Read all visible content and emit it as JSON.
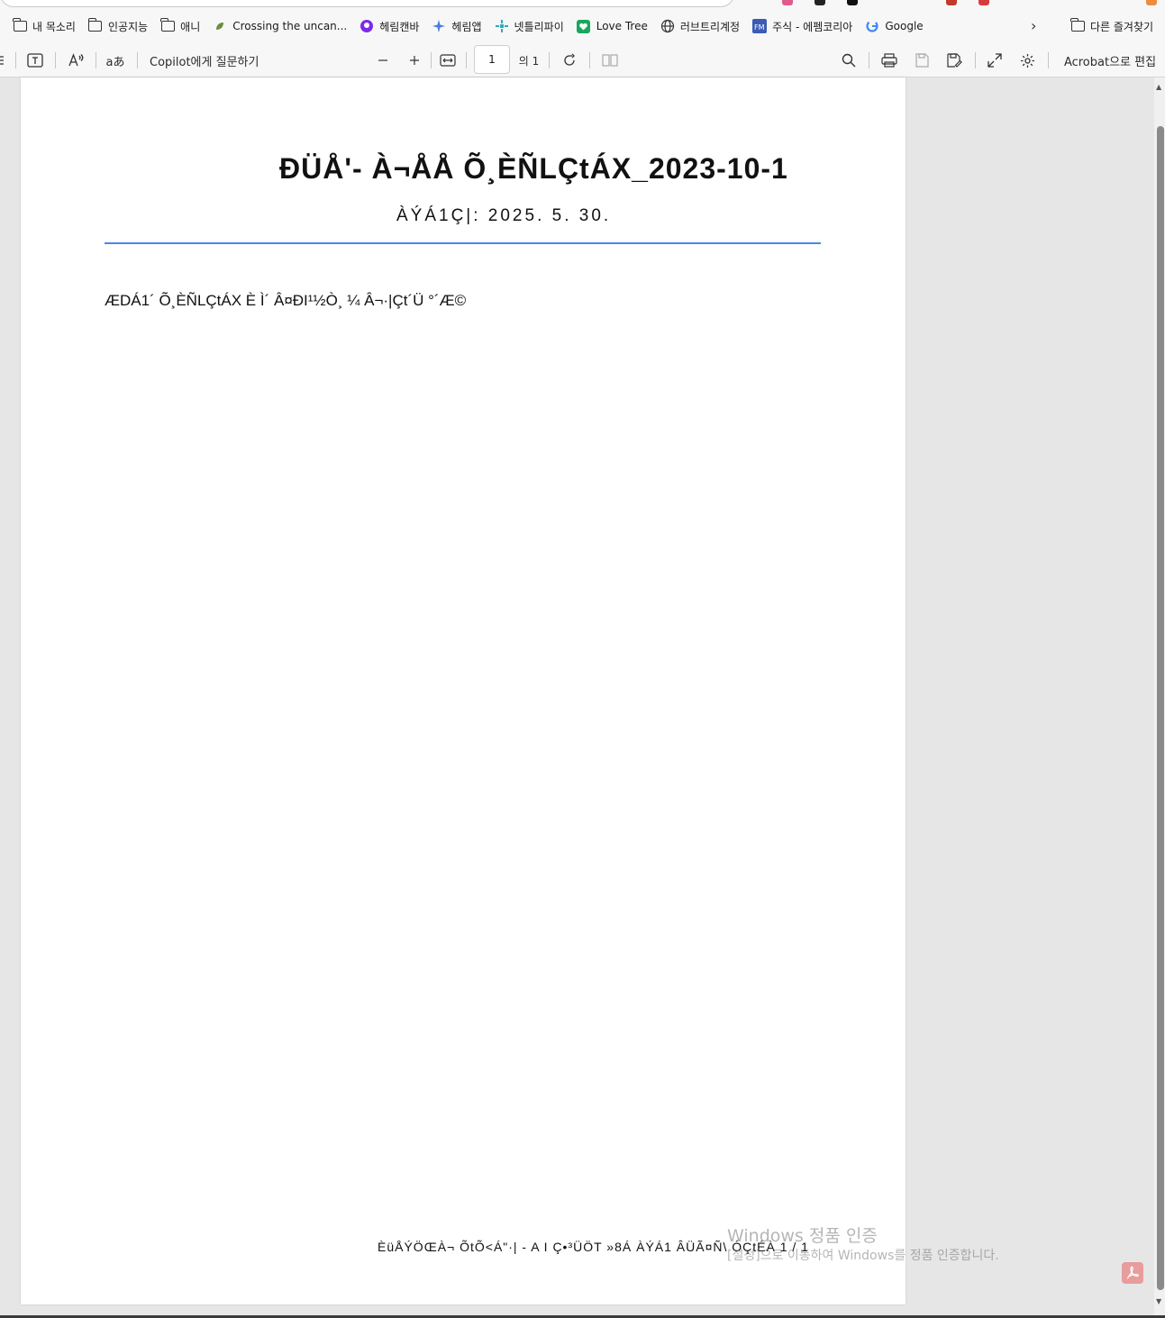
{
  "favorites": [
    {
      "label": "내 목소리",
      "icon": "folder-icon"
    },
    {
      "label": "인공지능",
      "icon": "folder-icon"
    },
    {
      "label": "애니",
      "icon": "folder-icon"
    },
    {
      "label": "Crossing the uncan...",
      "icon": "leaf-icon"
    },
    {
      "label": "헤림캔바",
      "icon": "canva-icon"
    },
    {
      "label": "헤림앱",
      "icon": "sparkle-icon"
    },
    {
      "label": "넷틀리파이",
      "icon": "netlify-icon"
    },
    {
      "label": "Love Tree",
      "icon": "love-tree-icon"
    },
    {
      "label": "러브트리계정",
      "icon": "globe-icon"
    },
    {
      "label": "주식 - 에펨코리아",
      "icon": "fm-icon"
    },
    {
      "label": "Google",
      "icon": "google-icon"
    }
  ],
  "other_favorites": "다른 즐겨찾기",
  "toolbar": {
    "copilot": "Copilot에게 질문하기",
    "page_current": "1",
    "page_total": "의 1",
    "acrobat_edit": "Acrobat으로 편집"
  },
  "document": {
    "title": "ÐÜÅ'-  À¬ÅÅ Õ¸ÈÑLÇtÁX_2023-10-1",
    "date": "ÀÝÁ1Ç|: 2025. 5. 30.",
    "body": "ÆDÁ1´ Õ¸ÈÑLÇtÁX È Ì´ Â¤ÐI¹½Ò¸ ¼  Â¬·|Çt´Ü °´Æ©",
    "footer": "ÈüÅÝÖŒÀ¬ ÕtÕ<Á\"·|  -  A I  Ç•³ÜÖT »8Á   ÀÝÁ1  ÂÜÃ¤Ñ\\    ÓÇtÉÀ  1  /  1"
  },
  "watermark": {
    "title": "Windows 정품 인증",
    "subtitle": "[설정]으로 이동하여 Windows를 정품 인증합니다."
  }
}
